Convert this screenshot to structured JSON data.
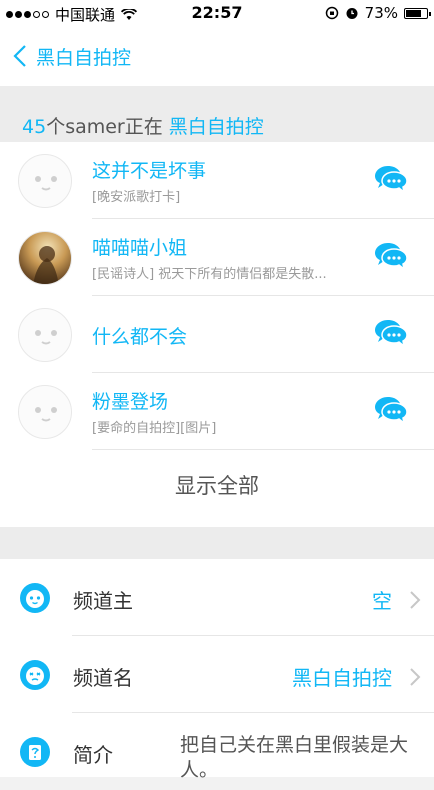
{
  "status_bar": {
    "carrier": "中国联通",
    "time": "22:57",
    "battery": "73%"
  },
  "nav": {
    "back_label": "黑白自拍控"
  },
  "members_header": {
    "count": "45",
    "middle": "个samer正在",
    "channel": "黑白自拍控"
  },
  "members": [
    {
      "name": "这并不是坏事",
      "sub": "[晚安派歌打卡]"
    },
    {
      "name": "喵喵喵小姐",
      "sub": "[民谣诗人] 祝天下所有的情侣都是失散..."
    },
    {
      "name": "什么都不会",
      "sub": ""
    },
    {
      "name": "粉墨登场",
      "sub": "[要命的自拍控][图片]"
    }
  ],
  "show_all": "显示全部",
  "settings": {
    "owner": {
      "label": "频道主",
      "value": "空"
    },
    "channel_name": {
      "label": "频道名",
      "value": "黑白自拍控"
    },
    "intro": {
      "label": "简介",
      "value": "把自己关在黑白里假装是大人。"
    }
  },
  "colors": {
    "accent": "#12b7f5"
  }
}
